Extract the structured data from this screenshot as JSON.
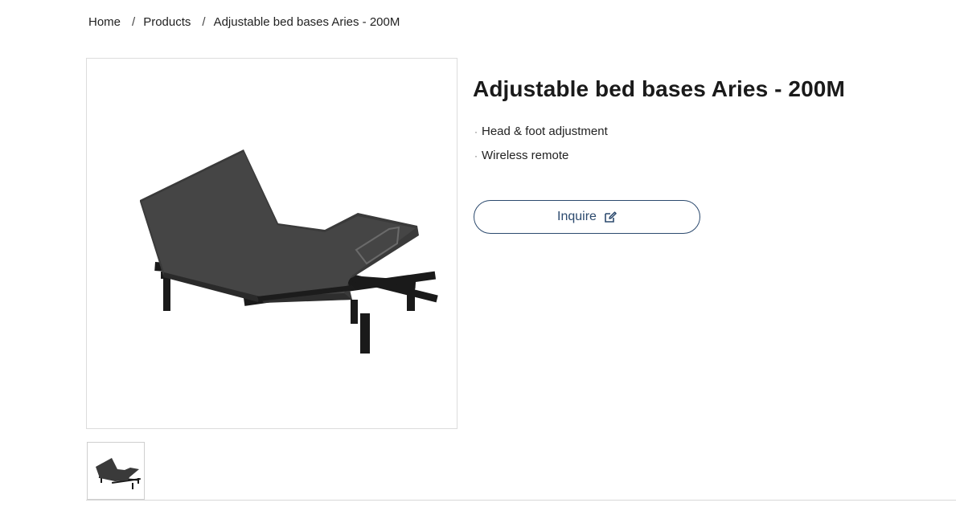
{
  "breadcrumb": {
    "home": "Home",
    "products": "Products",
    "current": "Adjustable bed bases Aries - 200M",
    "separator": "/"
  },
  "product": {
    "title": "Adjustable bed bases Aries - 200M",
    "feature_bullet": "·",
    "features": [
      "Head & foot adjustment",
      "Wireless remote"
    ],
    "inquire_label": "Inquire",
    "inquire_icon": "edit-icon"
  },
  "colors": {
    "accent": "#2c4a6e",
    "text": "#222222",
    "border": "#dcdcdc"
  }
}
